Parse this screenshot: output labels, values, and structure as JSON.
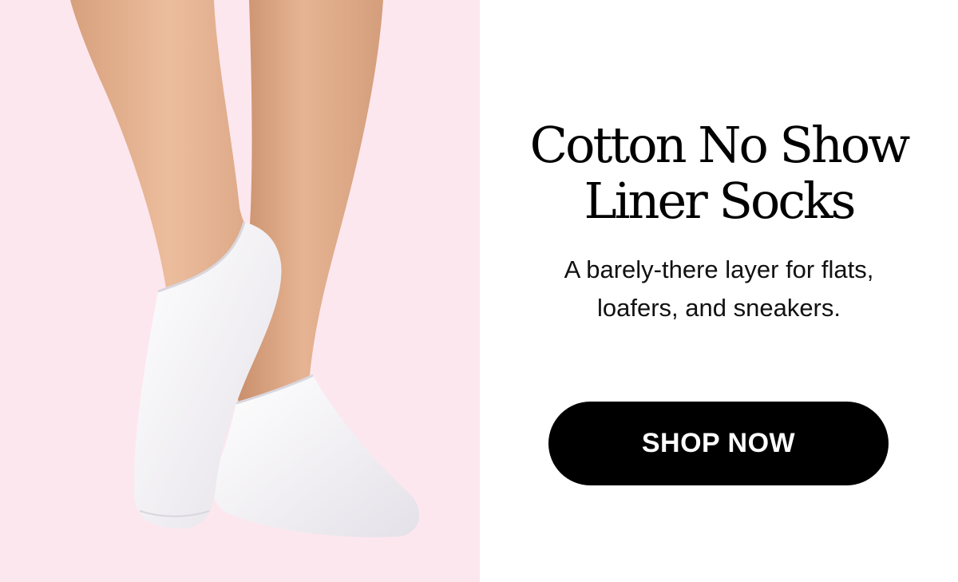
{
  "colors": {
    "photo_background": "#fde7ef",
    "skin": "#e8b896",
    "sock": "#f7f5f8",
    "button_background": "#000000",
    "button_text": "#ffffff"
  },
  "hero": {
    "image_icon": "legs-wearing-white-no-show-socks"
  },
  "content": {
    "headline_line1": "Cotton No Show",
    "headline_line2": "Liner Socks",
    "subhead_line1": "A barely-there layer for flats,",
    "subhead_line2": "loafers, and sneakers.",
    "cta_label": "SHOP NOW"
  }
}
